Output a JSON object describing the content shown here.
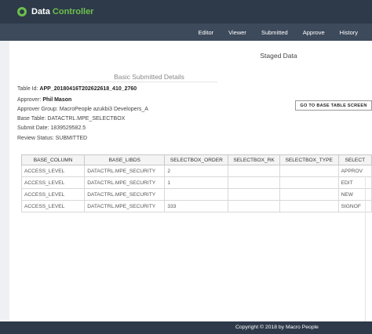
{
  "app": {
    "logo_text_1": "Data",
    "logo_text_2": "Controller",
    "brand_color": "#6cc04a",
    "header_bg": "#2e3a4a"
  },
  "nav": {
    "items": [
      "Editor",
      "Viewer",
      "Submitted",
      "Approve",
      "History"
    ]
  },
  "page": {
    "title": "Staged Data",
    "details_title": "Basic Submitted Details"
  },
  "details": {
    "table_id_label": "Table Id:",
    "table_id_value": "APP_20180416T202622618_410_2760",
    "approver_label": "Approver:",
    "approver_value": "Phil Mason",
    "approver_group": "Approver Group: MacroPeople azukbi3 Developers_A",
    "base_table": "Base Table: DATACTRL.MPE_SELECTBOX",
    "submit_date": "Submit Date: 1839529582.5",
    "review_status": "Review Status: SUBMITTED"
  },
  "goto_button": "GO TO BASE TABLE SCREEN",
  "table": {
    "headers": [
      "BASE_COLUMN",
      "BASE_LIBDS",
      "SELECTBOX_ORDER",
      "SELECTBOX_RK",
      "SELECTBOX_TYPE",
      "SELECT"
    ],
    "rows": [
      [
        "ACCESS_LEVEL",
        "DATACTRL.MPE_SECURITY",
        "2",
        "",
        "",
        "APPROV"
      ],
      [
        "ACCESS_LEVEL",
        "DATACTRL.MPE_SECURITY",
        "1",
        "",
        "",
        "EDIT"
      ],
      [
        "ACCESS_LEVEL",
        "DATACTRL.MPE_SECURITY",
        "",
        "",
        "",
        "NEW"
      ],
      [
        "ACCESS_LEVEL",
        "DATACTRL.MPE_SECURITY",
        "333",
        "",
        "",
        "SIGNOF"
      ]
    ]
  },
  "footer": {
    "text": "Copyright © 2018 by Macro People"
  }
}
